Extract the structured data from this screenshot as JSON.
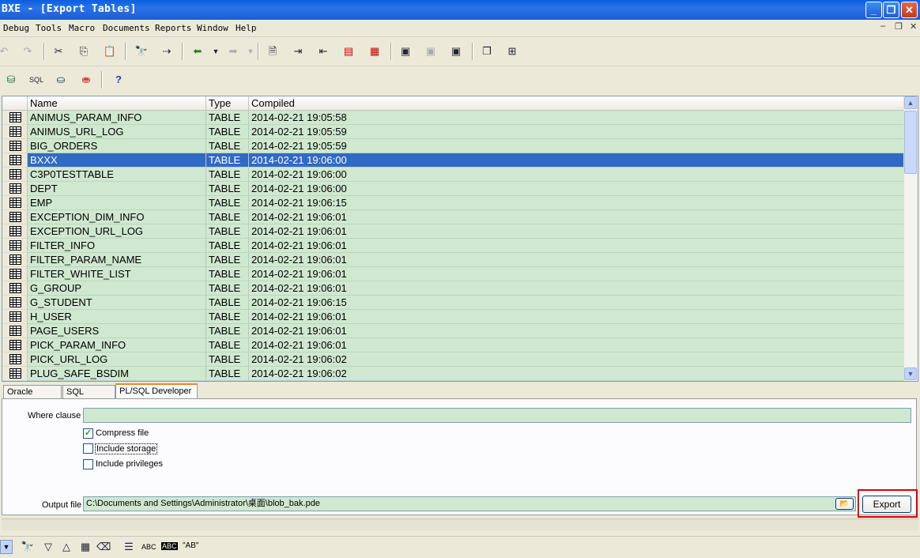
{
  "window": {
    "title": "BXE - [Export Tables]",
    "min": "_",
    "max": "❐",
    "close": "✕"
  },
  "menu": {
    "items": [
      "Debug",
      "Tools",
      "Macro",
      "Documents",
      "Reports",
      "Window",
      "Help"
    ],
    "mdi_min": "–",
    "mdi_restore": "❐",
    "mdi_close": "✕"
  },
  "toolbar1": [
    "undo-icon",
    "redo-icon",
    "cut-icon",
    "copy-icon",
    "paste-icon",
    "find-icon",
    "find-next-icon",
    "back-icon",
    "dropdown-icon",
    "forward-icon",
    "dropdown-icon",
    "new-doc-icon",
    "indent-icon",
    "outdent-icon",
    "comment-icon",
    "uncomment-icon",
    "window-icon",
    "window-disabled-icon",
    "window-check-icon",
    "cascade-icon",
    "tile-icon"
  ],
  "toolbar2": [
    "connect-icon",
    "sql-icon",
    "logon-icon",
    "logoff-icon",
    "help-icon"
  ],
  "grid": {
    "columns": [
      "Name",
      "Type",
      "Compiled"
    ],
    "rows": [
      {
        "name": "ANIMUS_PARAM_INFO",
        "type": "TABLE",
        "compiled": "2014-02-21 19:05:58"
      },
      {
        "name": "ANIMUS_URL_LOG",
        "type": "TABLE",
        "compiled": "2014-02-21 19:05:59"
      },
      {
        "name": "BIG_ORDERS",
        "type": "TABLE",
        "compiled": "2014-02-21 19:05:59"
      },
      {
        "name": "BXXX",
        "type": "TABLE",
        "compiled": "2014-02-21 19:06:00"
      },
      {
        "name": "C3P0TESTTABLE",
        "type": "TABLE",
        "compiled": "2014-02-21 19:06:00"
      },
      {
        "name": "DEPT",
        "type": "TABLE",
        "compiled": "2014-02-21 19:06:00"
      },
      {
        "name": "EMP",
        "type": "TABLE",
        "compiled": "2014-02-21 19:06:15"
      },
      {
        "name": "EXCEPTION_DIM_INFO",
        "type": "TABLE",
        "compiled": "2014-02-21 19:06:01"
      },
      {
        "name": "EXCEPTION_URL_LOG",
        "type": "TABLE",
        "compiled": "2014-02-21 19:06:01"
      },
      {
        "name": "FILTER_INFO",
        "type": "TABLE",
        "compiled": "2014-02-21 19:06:01"
      },
      {
        "name": "FILTER_PARAM_NAME",
        "type": "TABLE",
        "compiled": "2014-02-21 19:06:01"
      },
      {
        "name": "FILTER_WHITE_LIST",
        "type": "TABLE",
        "compiled": "2014-02-21 19:06:01"
      },
      {
        "name": "G_GROUP",
        "type": "TABLE",
        "compiled": "2014-02-21 19:06:01"
      },
      {
        "name": "G_STUDENT",
        "type": "TABLE",
        "compiled": "2014-02-21 19:06:15"
      },
      {
        "name": "H_USER",
        "type": "TABLE",
        "compiled": "2014-02-21 19:06:01"
      },
      {
        "name": "PAGE_USERS",
        "type": "TABLE",
        "compiled": "2014-02-21 19:06:01"
      },
      {
        "name": "PICK_PARAM_INFO",
        "type": "TABLE",
        "compiled": "2014-02-21 19:06:01"
      },
      {
        "name": "PICK_URL_LOG",
        "type": "TABLE",
        "compiled": "2014-02-21 19:06:02"
      },
      {
        "name": "PLUG_SAFE_BSDIM",
        "type": "TABLE",
        "compiled": "2014-02-21 19:06:02"
      }
    ],
    "selected_index": 3,
    "scroll_up": "▲",
    "scroll_down": "▼"
  },
  "tabs": [
    "Oracle Export",
    "SQL Inserts",
    "PL/SQL Developer"
  ],
  "active_tab": 2,
  "options": {
    "where_label": "Where clause",
    "where_value": "",
    "compress": {
      "label": "Compress file",
      "checked": true
    },
    "storage": {
      "label": "Include storage",
      "checked": false
    },
    "privileges": {
      "label": "Include privileges",
      "checked": false
    },
    "output_label": "Output file",
    "output_value": "C:\\Documents and Settings\\Administrator\\桌面\\blob_bak.pde",
    "export_button": "Export",
    "check_mark": "✓"
  },
  "bottom_toolbar": {
    "abc": "ABC",
    "ab_quote": "\"AB\"",
    "icons": [
      "dropdown-icon",
      "find-icon",
      "triangle-down-icon",
      "triangle-up-icon",
      "grid-icon",
      "eraser-icon",
      "select-icon",
      "abc-icon",
      "abc-highlight-icon",
      "quote-ab-icon"
    ]
  },
  "colors": {
    "grid_bg": "#cfe8cf",
    "selection": "#316ac5",
    "highlight_frame": "#e00000"
  }
}
